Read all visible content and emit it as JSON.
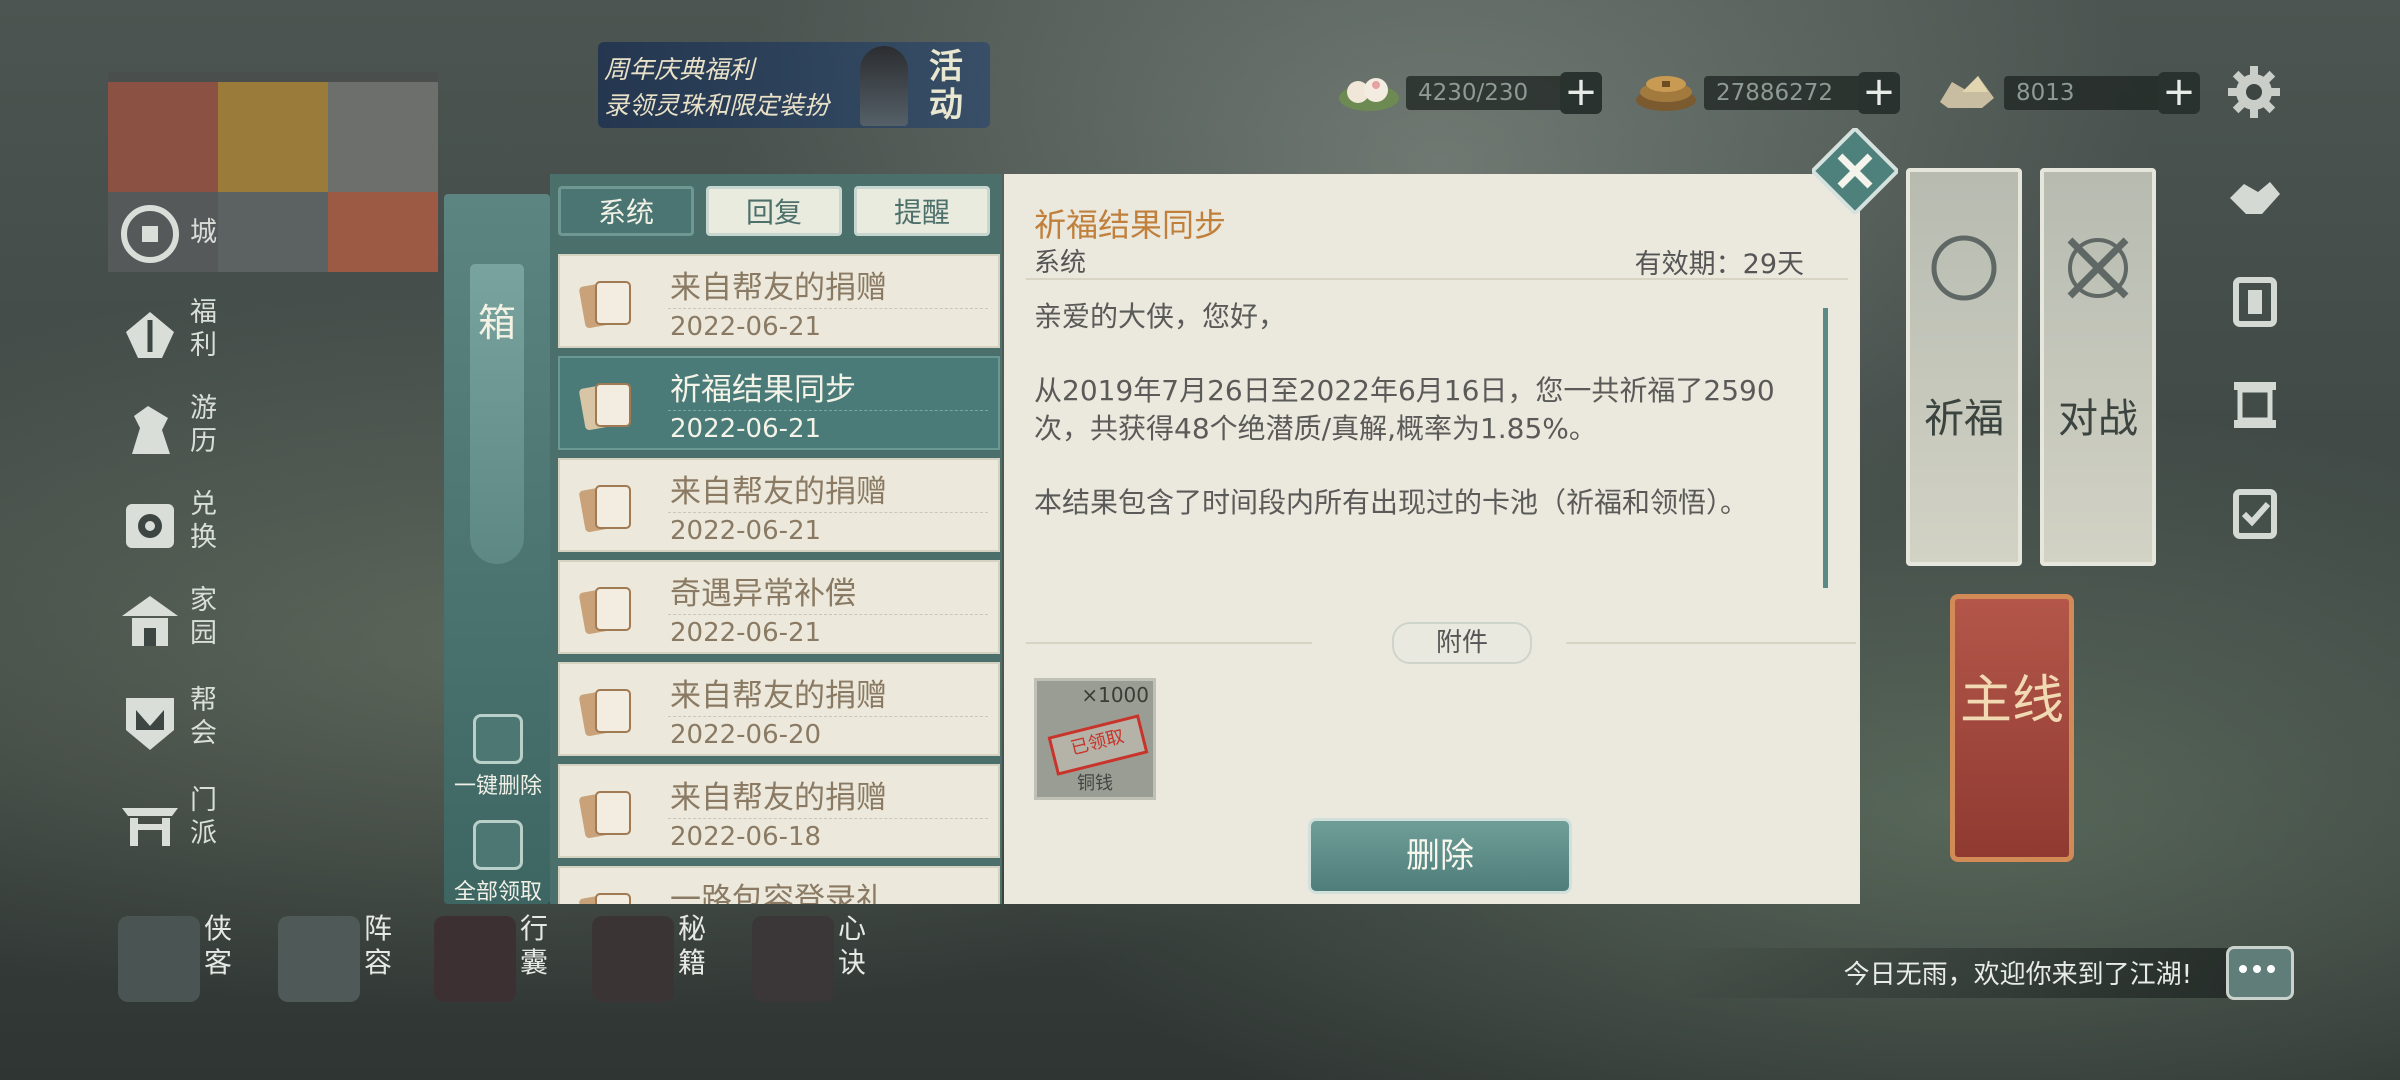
{
  "event_banner": {
    "line1": "周年庆典福利",
    "line2": "录领灵珠和限定装扮",
    "tag": "活动"
  },
  "currencies": [
    {
      "icon": "peach-bun-icon",
      "value": "4230/230"
    },
    {
      "icon": "copper-coins-icon",
      "value": "27886272"
    },
    {
      "icon": "silver-ingot-icon",
      "value": "8013"
    }
  ],
  "left_nav": [
    {
      "icon": "shop-icon",
      "label": "城"
    },
    {
      "icon": "gift-icon",
      "label": "福利"
    },
    {
      "icon": "horse-icon",
      "label": "游历"
    },
    {
      "icon": "exchange-icon",
      "label": "兑换"
    },
    {
      "icon": "pavilion-icon",
      "label": "家园"
    },
    {
      "icon": "guild-emblem-icon",
      "label": "帮会"
    },
    {
      "icon": "sect-gate-icon",
      "label": "门派"
    }
  ],
  "bottom_nav": [
    {
      "icon": "hero-icon",
      "label": "侠客"
    },
    {
      "icon": "formation-icon",
      "label": "阵容"
    },
    {
      "icon": "bag-icon",
      "label": "行囊"
    },
    {
      "icon": "book-icon",
      "label": "秘籍"
    },
    {
      "icon": "flame-icon",
      "label": "心诀"
    }
  ],
  "right_side": {
    "cards": [
      "祈福",
      "对战"
    ],
    "main_quest": "主线",
    "chat_message": "今日无雨，欢迎你来到了江湖!"
  },
  "mailbox": {
    "side_title": "箱",
    "delete_all": "一键删除",
    "claim_all": "全部领取",
    "tabs": [
      "系统",
      "回复",
      "提醒"
    ],
    "mails": [
      {
        "subject": "来自帮友的捐赠",
        "date": "2022-06-21"
      },
      {
        "subject": "祈福结果同步",
        "date": "2022-06-21"
      },
      {
        "subject": "来自帮友的捐赠",
        "date": "2022-06-21"
      },
      {
        "subject": "奇遇异常补偿",
        "date": "2022-06-21"
      },
      {
        "subject": "来自帮友的捐赠",
        "date": "2022-06-20"
      },
      {
        "subject": "来自帮友的捐赠",
        "date": "2022-06-18"
      },
      {
        "subject": "一路包容登录礼",
        "date": ""
      }
    ]
  },
  "mail_detail": {
    "title": "祈福结果同步",
    "sender": "系统",
    "expiry": "有效期：29天",
    "greeting": "亲爱的大侠，您好，",
    "paragraph1": "从2019年7月26日至2022年6月16日，您一共祈福了2590次，共获得48个绝潜质/真解,概率为1.85%。",
    "paragraph2": "本结果包含了时间段内所有出现过的卡池（祈福和领悟）。",
    "attachment_label": "附件",
    "attachment": {
      "quantity": "×1000",
      "stamp": "已领取",
      "name": "铜钱"
    },
    "delete_button": "删除"
  },
  "colors": {
    "accent_teal": "#4a7b78",
    "title_orange": "#c0803c",
    "stamp_red": "#c8332a"
  }
}
